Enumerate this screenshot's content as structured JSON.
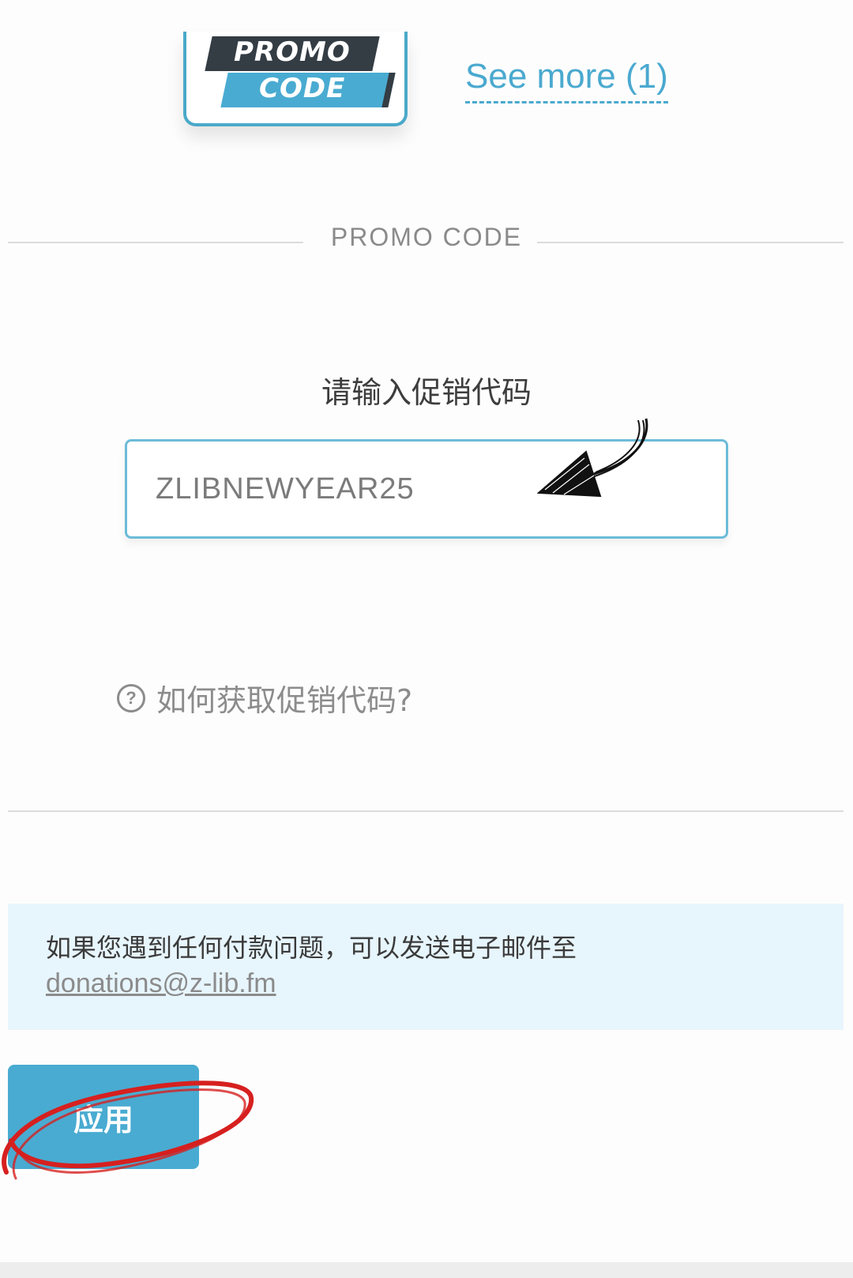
{
  "promo_badge": {
    "line1": "PROMO",
    "line2": "CODE"
  },
  "see_more": "See more (1)",
  "section_title": "PROMO CODE",
  "prompt": "请输入促销代码",
  "promo_input": {
    "value": "ZLIBNEWYEAR25"
  },
  "help": {
    "icon": "question-circle-icon",
    "label": "如何获取促销代码?"
  },
  "notice": {
    "text": "如果您遇到任何付款问题，可以发送电子邮件至",
    "email": "donations@z-lib.fm"
  },
  "apply_button": "应用",
  "colors": {
    "accent": "#49abd1",
    "dark_band": "#343c44",
    "notice_bg": "#e7f5fd",
    "annotation_red": "#d6201f"
  }
}
